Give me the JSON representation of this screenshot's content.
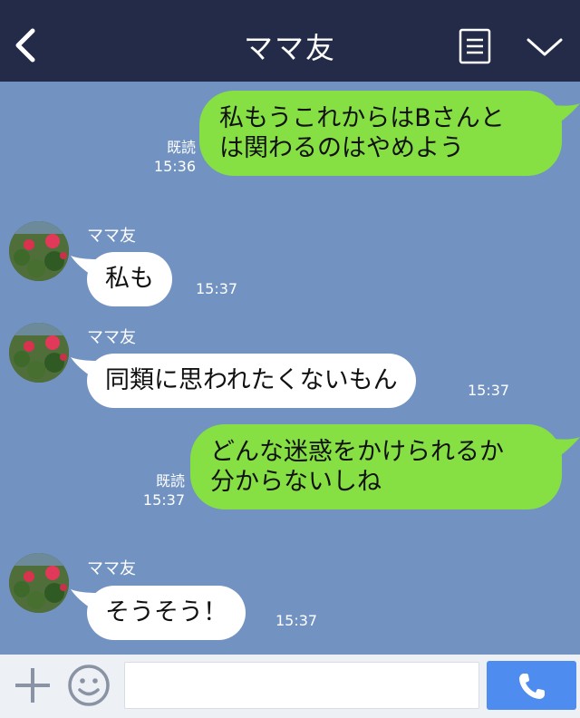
{
  "header": {
    "title": "ママ友"
  },
  "messages": [
    {
      "from": "me",
      "lines": [
        "私もうこれからはBさんと",
        "は関わるのはやめよう"
      ],
      "read": "既読",
      "time": "15:36"
    },
    {
      "from": "other",
      "sender": "ママ友",
      "text": "私も",
      "time": "15:37"
    },
    {
      "from": "other",
      "sender": "ママ友",
      "text": "同類に思われたくないもん",
      "time": "15:37"
    },
    {
      "from": "me",
      "lines": [
        "どんな迷惑をかけられるか",
        "分からないしね"
      ],
      "read": "既読",
      "time": "15:37"
    },
    {
      "from": "other",
      "sender": "ママ友",
      "text": "そうそう！",
      "time": "15:37"
    }
  ],
  "colors": {
    "header_bg": "#232b48",
    "chat_bg": "#7293c2",
    "my_bubble": "#86e043",
    "their_bubble": "#ffffff",
    "call_button": "#4f8cf0"
  },
  "icons": [
    "back-icon",
    "menu-icon",
    "chevron-down-icon",
    "plus-icon",
    "smiley-icon",
    "phone-icon"
  ]
}
